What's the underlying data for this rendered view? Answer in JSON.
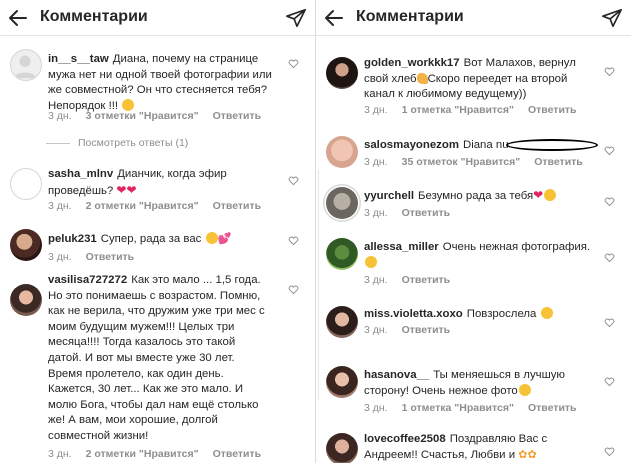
{
  "left": {
    "header": {
      "title": "Комментарии"
    },
    "more_replies": "Посмотреть ответы (1)",
    "comments": [
      {
        "user": "in__s__taw",
        "text": "Диана, почему на странице мужа нет ни одной  твоей фотографии или же совместной? Он что стесняется тебя? Непорядок !!!",
        "time": "3 дн.",
        "likes": "",
        "reply": "Ответить"
      },
      {
        "user": "sasha_mlnv",
        "text": "Дианчик, когда эфир проведёшь?",
        "time": "3 дн.",
        "likes": "2 отметки \"Нравится\"",
        "reply": "Ответить"
      },
      {
        "user": "peluk231",
        "text": "Супер, рада за вас",
        "time": "3 дн.",
        "likes": "",
        "reply": "Ответить"
      },
      {
        "user": "vasilisa727272",
        "text": "Как это мало ... 1,5 года. Но это понимаешь с возрастом. Помню, как не верила, что дружим уже три мес с моим будущим мужем!!! Целых три месяца!!!! Тогда казалось это такой датой. И вот мы вместе уже 30 лет. Время пролетело, как один день. Кажется, 30 лет... Как же это мало. И молю Бога, чтобы дал нам ещё столько же! А вам, мои хорошие, долгой совместной жизни!",
        "time": "3 дн.",
        "likes": "2 отметки \"Нравится\"",
        "reply": "Ответить"
      }
    ],
    "first_likes": "3 отметки \"Нравится\""
  },
  "right": {
    "header": {
      "title": "Комментарии"
    },
    "comments": [
      {
        "user": "golden_workkk17",
        "text": "Вот Малахов, вернул свой хлеб",
        "text2": "Скоро переедет на второй канал к любимому ведущему))",
        "time": "3 дн.",
        "likes": "1 отметка \"Нравится\"",
        "reply": "Ответить"
      },
      {
        "user": "salosmayonezom",
        "text": "Diana nu",
        "time": "3 дн.",
        "likes": "35 отметок \"Нравится\"",
        "reply": "Ответить"
      },
      {
        "user": "yyurchell",
        "text": "Безумно рада за тебя",
        "time": "3 дн.",
        "likes": "",
        "reply": "Ответить"
      },
      {
        "user": "allessa_miller",
        "text": "Очень нежная фотография.",
        "time": "3 дн.",
        "likes": "",
        "reply": "Ответить"
      },
      {
        "user": "miss.violetta.xoxo",
        "text": "Повзрослела",
        "time": "3 дн.",
        "likes": "",
        "reply": "Ответить"
      },
      {
        "user": "hasanova__",
        "text": "Ты меняешься в лучшую сторону! Очень нежное фото",
        "time": "3 дн.",
        "likes": "1 отметка \"Нравится\"",
        "reply": "Ответить"
      },
      {
        "user": "lovecoffee2508",
        "text": "Поздравляю Вас с Андреем!! Счастья, Любви и",
        "time": "",
        "likes": "",
        "reply": ""
      }
    ]
  },
  "colors": {
    "text": "#262626",
    "meta": "#8e8e8e",
    "divider": "#dbdbdb",
    "heart": "#e0245e"
  },
  "icons": [
    "back-arrow-icon",
    "send-icon",
    "heart-outline-icon"
  ]
}
